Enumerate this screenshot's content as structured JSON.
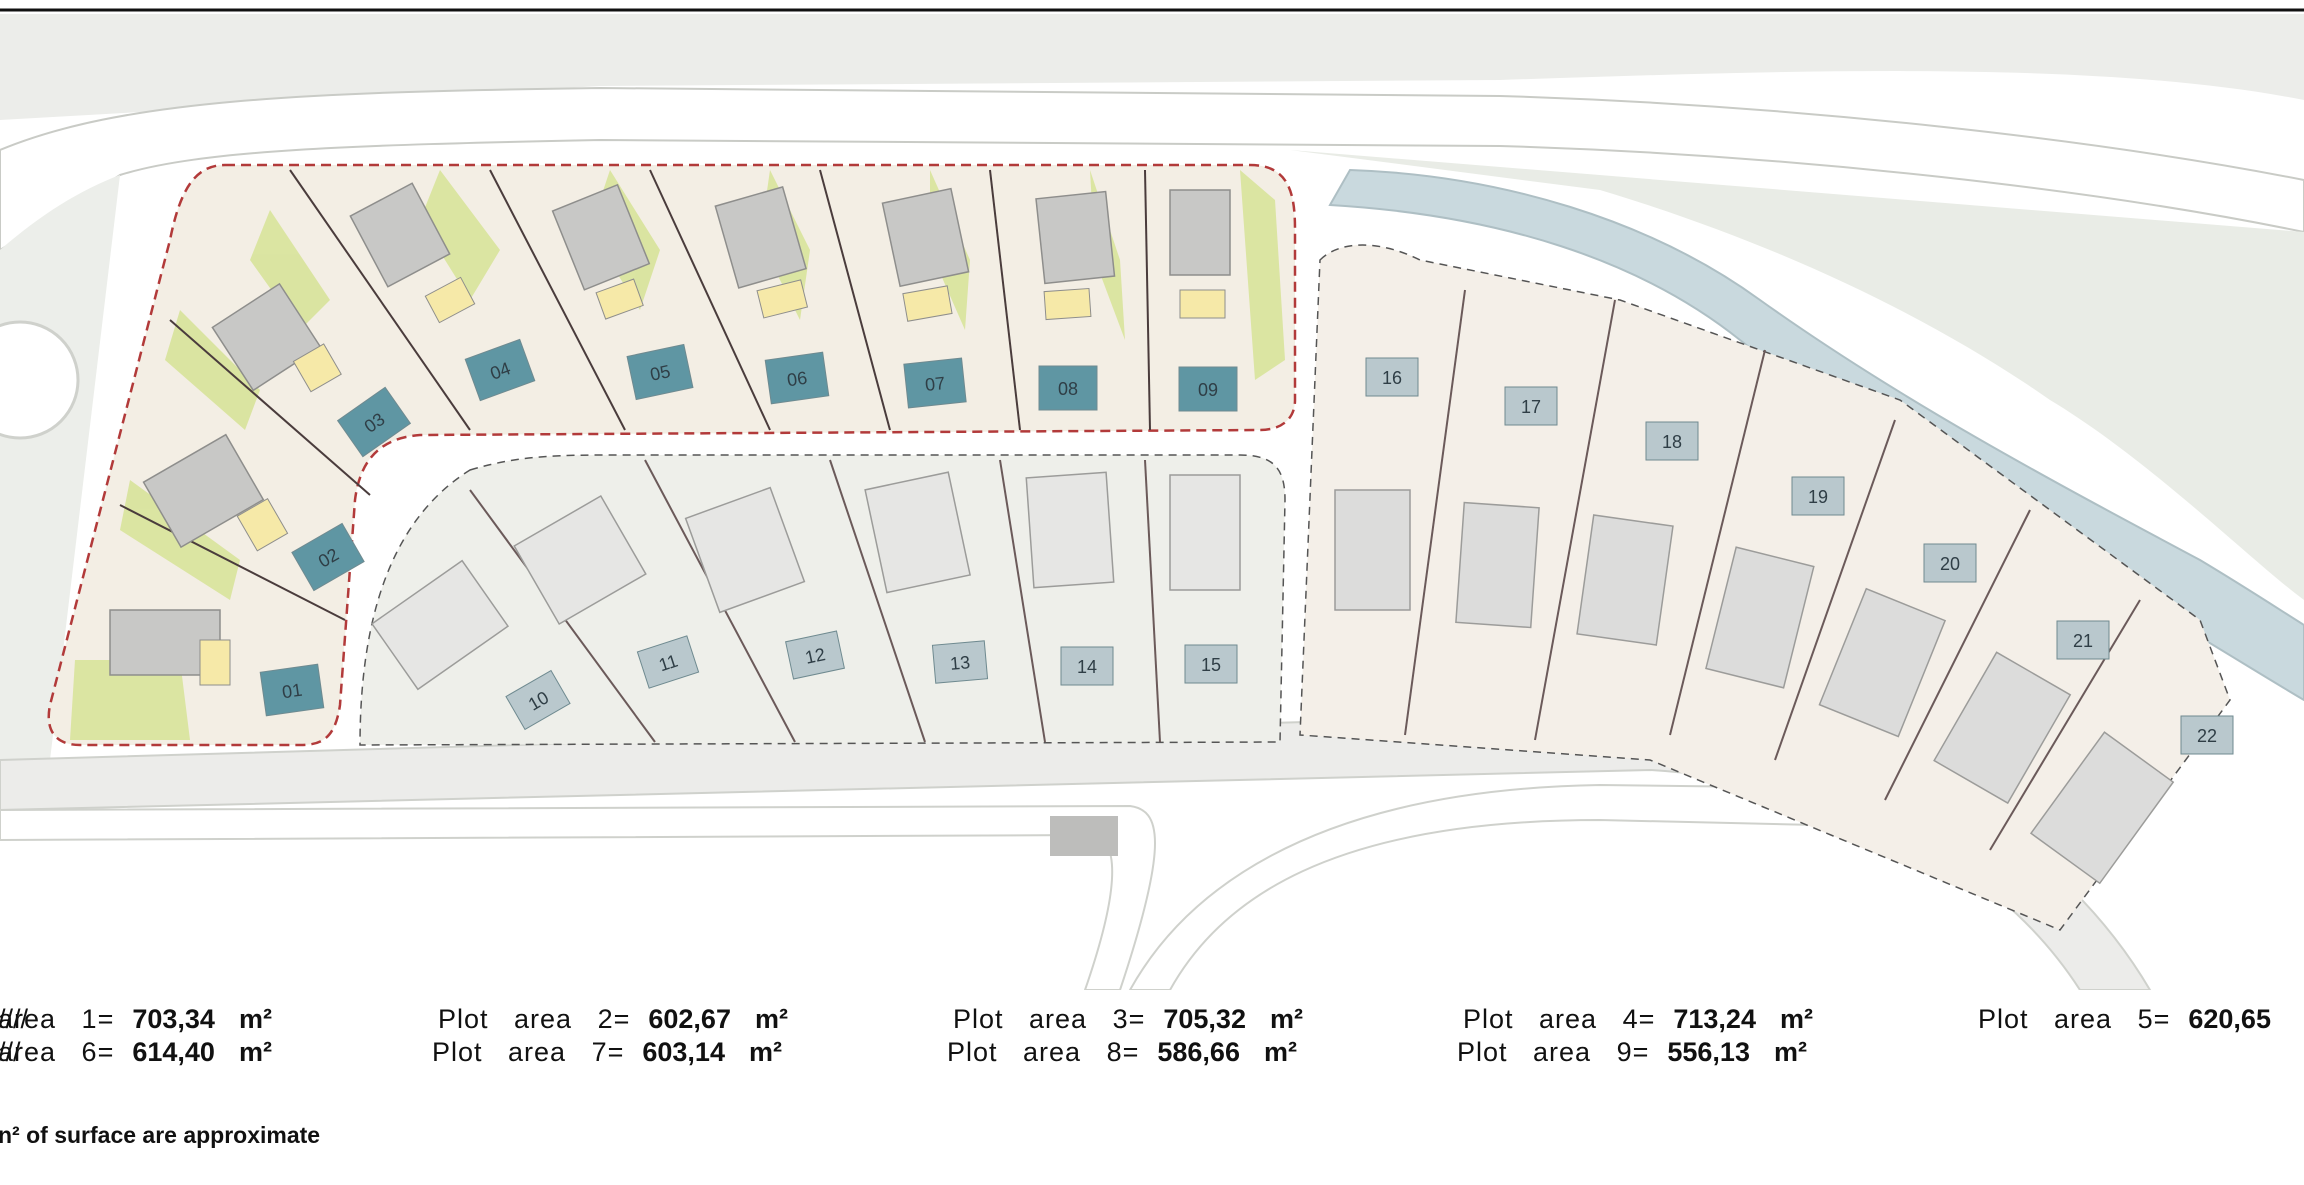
{
  "plots": [
    {
      "id": "01",
      "kind": "featured"
    },
    {
      "id": "02",
      "kind": "featured"
    },
    {
      "id": "03",
      "kind": "featured"
    },
    {
      "id": "04",
      "kind": "featured"
    },
    {
      "id": "05",
      "kind": "featured"
    },
    {
      "id": "06",
      "kind": "featured"
    },
    {
      "id": "07",
      "kind": "featured"
    },
    {
      "id": "08",
      "kind": "featured"
    },
    {
      "id": "09",
      "kind": "featured"
    },
    {
      "id": "10",
      "kind": "other"
    },
    {
      "id": "11",
      "kind": "other"
    },
    {
      "id": "12",
      "kind": "other"
    },
    {
      "id": "13",
      "kind": "other"
    },
    {
      "id": "14",
      "kind": "other"
    },
    {
      "id": "15",
      "kind": "other"
    },
    {
      "id": "16",
      "kind": "other"
    },
    {
      "id": "17",
      "kind": "other"
    },
    {
      "id": "18",
      "kind": "other"
    },
    {
      "id": "19",
      "kind": "other"
    },
    {
      "id": "20",
      "kind": "other"
    },
    {
      "id": "21",
      "kind": "other"
    },
    {
      "id": "22",
      "kind": "other"
    }
  ],
  "colors": {
    "featured_pool": "#5f96a3",
    "other_pool": "#b9c8cd",
    "green_area": "#d8e39a",
    "terrace": "#f1dcc0",
    "river": "#c9d9de",
    "road": "#eceeea",
    "featured_boundary": "#b23a3a"
  },
  "areas": {
    "rows": [
      [
        {
          "label": "area",
          "n": "1=",
          "value": "703,34",
          "unit": "m²",
          "sep": "/"
        },
        {
          "label": "Plot   area",
          "n": "2=",
          "value": "602,67",
          "unit": "m²",
          "sep": "/"
        },
        {
          "label": "Plot   area",
          "n": "3=",
          "value": "705,32",
          "unit": "m²",
          "sep": "/"
        },
        {
          "label": "Plot   area",
          "n": "4=",
          "value": "713,24",
          "unit": "m²",
          "sep": "/"
        },
        {
          "label": "Plot   area",
          "n": "5=",
          "value": "620,65",
          "unit": "",
          "sep": ""
        }
      ],
      [
        {
          "label": "area",
          "n": "6=",
          "value": "614,40",
          "unit": "m²",
          "sep": "/"
        },
        {
          "label": "Plot   area",
          "n": "7=",
          "value": "603,14",
          "unit": "m²",
          "sep": "/"
        },
        {
          "label": "Plot   area",
          "n": "8=",
          "value": "586,66",
          "unit": "m²",
          "sep": "/"
        },
        {
          "label": "Plot   area",
          "n": "9=",
          "value": "556,13",
          "unit": "m²",
          "sep": ""
        }
      ]
    ],
    "footnote": "n² of surface are approximate"
  }
}
